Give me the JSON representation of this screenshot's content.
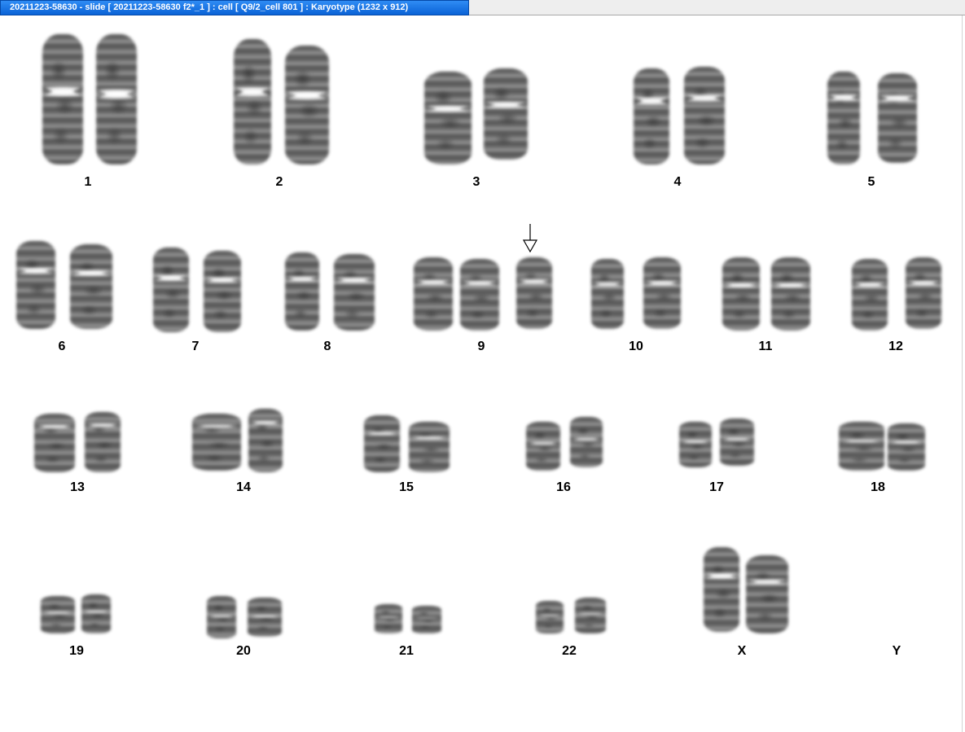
{
  "window": {
    "title": "20211223-58630 - slide [ 20211223-58630 f2*_1 ] : cell [ Q9/2_cell 801 ] : Karyotype  (1232 x 912)"
  },
  "karyotype": {
    "labels": [
      "1",
      "2",
      "3",
      "4",
      "5",
      "6",
      "7",
      "8",
      "9",
      "10",
      "11",
      "12",
      "13",
      "14",
      "15",
      "16",
      "17",
      "18",
      "19",
      "20",
      "21",
      "22",
      "X",
      "Y"
    ],
    "marker": {
      "icon": "down-arrow-icon",
      "target_chromosome": "9"
    }
  }
}
